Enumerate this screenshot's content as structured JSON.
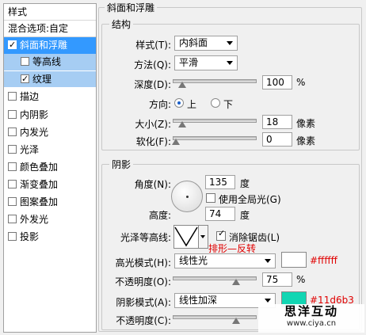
{
  "left_panel": {
    "header": "样式",
    "blend": "混合选项:自定",
    "items": [
      {
        "label": "斜面和浮雕",
        "checked": true
      },
      {
        "label": "等高线",
        "checked": false
      },
      {
        "label": "纹理",
        "checked": true
      },
      {
        "label": "描边",
        "checked": false
      },
      {
        "label": "内阴影",
        "checked": false
      },
      {
        "label": "内发光",
        "checked": false
      },
      {
        "label": "光泽",
        "checked": false
      },
      {
        "label": "颜色叠加",
        "checked": false
      },
      {
        "label": "渐变叠加",
        "checked": false
      },
      {
        "label": "图案叠加",
        "checked": false
      },
      {
        "label": "外发光",
        "checked": false
      },
      {
        "label": "投影",
        "checked": false
      }
    ]
  },
  "main": {
    "group_title": "斜面和浮雕",
    "structure": {
      "title": "结构",
      "style_label": "样式(T):",
      "style_value": "内斜面",
      "method_label": "方法(Q):",
      "method_value": "平滑",
      "depth_label": "深度(D):",
      "depth_value": "100",
      "depth_unit": "%",
      "direction_label": "方向:",
      "dir_up": "上",
      "dir_down": "下",
      "size_label": "大小(Z):",
      "size_value": "18",
      "size_unit": "像素",
      "soften_label": "软化(F):",
      "soften_value": "0",
      "soften_unit": "像素"
    },
    "shading": {
      "title": "阴影",
      "angle_label": "角度(N):",
      "angle_value": "135",
      "angle_unit": "度",
      "global_light_label": "使用全局光(G)",
      "altitude_label": "高度:",
      "altitude_value": "74",
      "altitude_unit": "度",
      "gloss_label": "光泽等高线:",
      "antialias_label": "消除锯齿(L)",
      "annotation": "排形—反转",
      "highlight_label": "高光模式(H):",
      "highlight_value": "线性光",
      "highlight_color": "#ffffff",
      "highlight_color_label": "#ffffff",
      "hl_opacity_label": "不透明度(O):",
      "hl_opacity_value": "75",
      "hl_opacity_unit": "%",
      "shadow_label": "阴影模式(A):",
      "shadow_value": "线性加深",
      "shadow_color": "#11d6b3",
      "shadow_color_label": "#11d6b3",
      "sh_opacity_label": "不透明度(C):"
    }
  },
  "watermark": {
    "line1": "思洋互动",
    "line2": "www.ciya.cn"
  }
}
